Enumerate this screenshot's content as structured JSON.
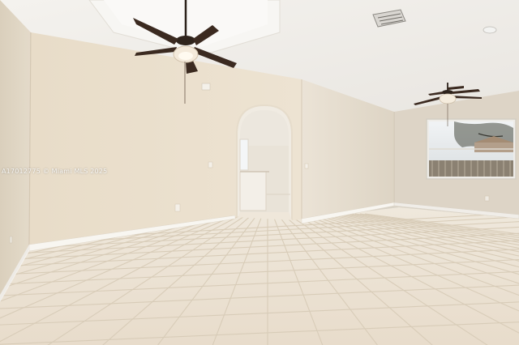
{
  "watermark": {
    "text": "A17012775 © Miami MLS 2025"
  },
  "scene": {
    "description_colors": {
      "ceiling": "#f2f0ec",
      "wall_left": "#e7dcc9",
      "wall_back": "#eadfcc",
      "wall_right": "#e4dccd",
      "floor": "#efe6d8",
      "grout": "#d6cbb9",
      "baseboard": "#f7f5f0",
      "fan_blade": "#3b2a20"
    },
    "icons": [
      "ceiling-fan-icon",
      "ceiling-fan-icon",
      "air-vent-icon",
      "smoke-detector-icon",
      "window-icon"
    ]
  }
}
